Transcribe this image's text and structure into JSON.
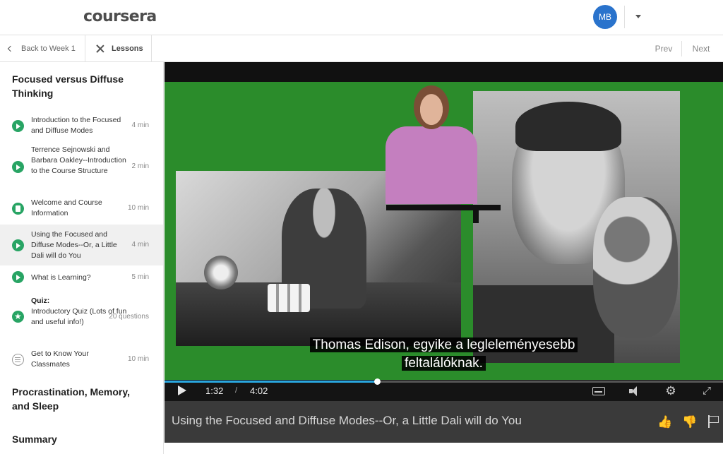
{
  "header": {
    "logo": "coursera",
    "avatar_initials": "MB"
  },
  "subnav": {
    "back_label": "Back to Week 1",
    "lessons_label": "Lessons",
    "prev_label": "Prev",
    "next_label": "Next"
  },
  "sidebar": {
    "section1_title": "Focused versus Diffuse Thinking",
    "items": [
      {
        "type": "video",
        "title": "Introduction to the Focused and Diffuse Modes",
        "duration": "4 min"
      },
      {
        "type": "video",
        "title": "Terrence Sejnowski and Barbara Oakley--Introduction to the Course Structure",
        "duration": "2 min"
      },
      {
        "type": "reading",
        "title": "Welcome and Course Information",
        "duration": "10 min"
      },
      {
        "type": "video",
        "title": "Using the Focused and Diffuse Modes--Or, a Little Dali will do You",
        "duration": "4 min",
        "active": true
      },
      {
        "type": "video",
        "title": "What is Learning?",
        "duration": "5 min"
      },
      {
        "type": "quiz",
        "prefix": "Quiz:",
        "title": "Introductory Quiz (Lots of fun and useful info!)",
        "duration": "20 questions"
      },
      {
        "type": "discussion",
        "title": "Get to Know Your Classmates",
        "duration": "10 min"
      }
    ],
    "section2_title": "Procrastination, Memory, and Sleep",
    "section3_title": "Summary"
  },
  "video": {
    "subtitle_line1": "Thomas Edison, egyike a legleleményesebb",
    "subtitle_line2": "feltalálóknak.",
    "current_time": "1:32",
    "time_separator": "/",
    "total_time": "4:02",
    "progress": 0.38,
    "accent_color": "#2aa7e0",
    "title": "Using the Focused and Diffuse Modes--Or, a Little Dali will do You"
  },
  "icons": {
    "play": "play-icon",
    "captions": "closed-captions-icon",
    "volume": "volume-icon",
    "settings": "gear-icon",
    "fullscreen": "fullscreen-icon",
    "like": "thumbs-up-icon",
    "dislike": "thumbs-down-icon",
    "flag": "flag-icon"
  }
}
